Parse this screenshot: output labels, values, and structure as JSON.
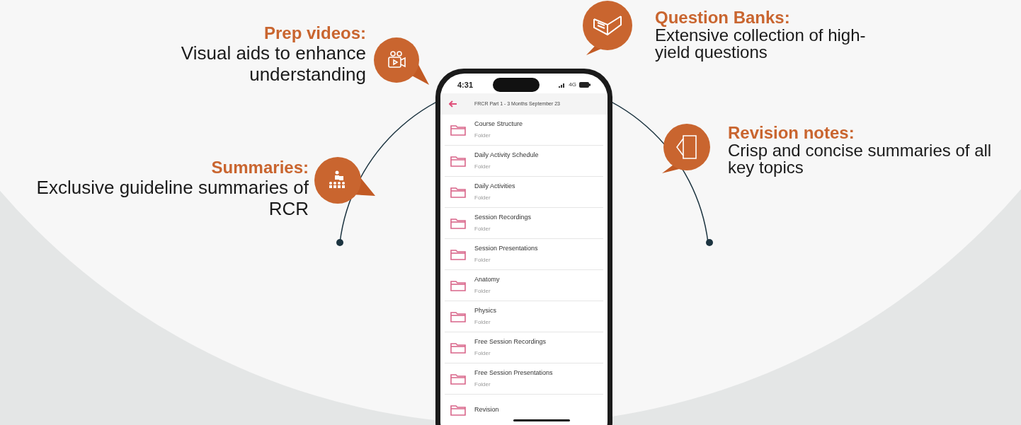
{
  "features": [
    {
      "kind": "video",
      "title": "Prep videos:",
      "text": "Visual aids to enhance understanding"
    },
    {
      "kind": "summary",
      "title": "Summaries:",
      "text": "Exclusive guideline summaries of RCR"
    },
    {
      "kind": "book",
      "title": "Question Banks:",
      "text": "Extensive collection of high-yield questions"
    },
    {
      "kind": "notes",
      "title": "Revision notes:",
      "text": "Crisp and concise summaries of all key topics"
    }
  ],
  "phone": {
    "time": "4:31",
    "network": "4G",
    "title": "FRCR Part 1 - 3 Months September 23",
    "items": [
      {
        "title": "Course Structure",
        "subtitle": "Folder"
      },
      {
        "title": "Daily Activity Schedule",
        "subtitle": "Folder"
      },
      {
        "title": "Daily Activities",
        "subtitle": "Folder"
      },
      {
        "title": "Session Recordings",
        "subtitle": "Folder"
      },
      {
        "title": "Session Presentations",
        "subtitle": "Folder"
      },
      {
        "title": "Anatomy",
        "subtitle": "Folder"
      },
      {
        "title": "Physics",
        "subtitle": "Folder"
      },
      {
        "title": "Free Session Recordings",
        "subtitle": "Folder"
      },
      {
        "title": "Free Session Presentations",
        "subtitle": "Folder"
      },
      {
        "title": "Revision"
      }
    ]
  }
}
